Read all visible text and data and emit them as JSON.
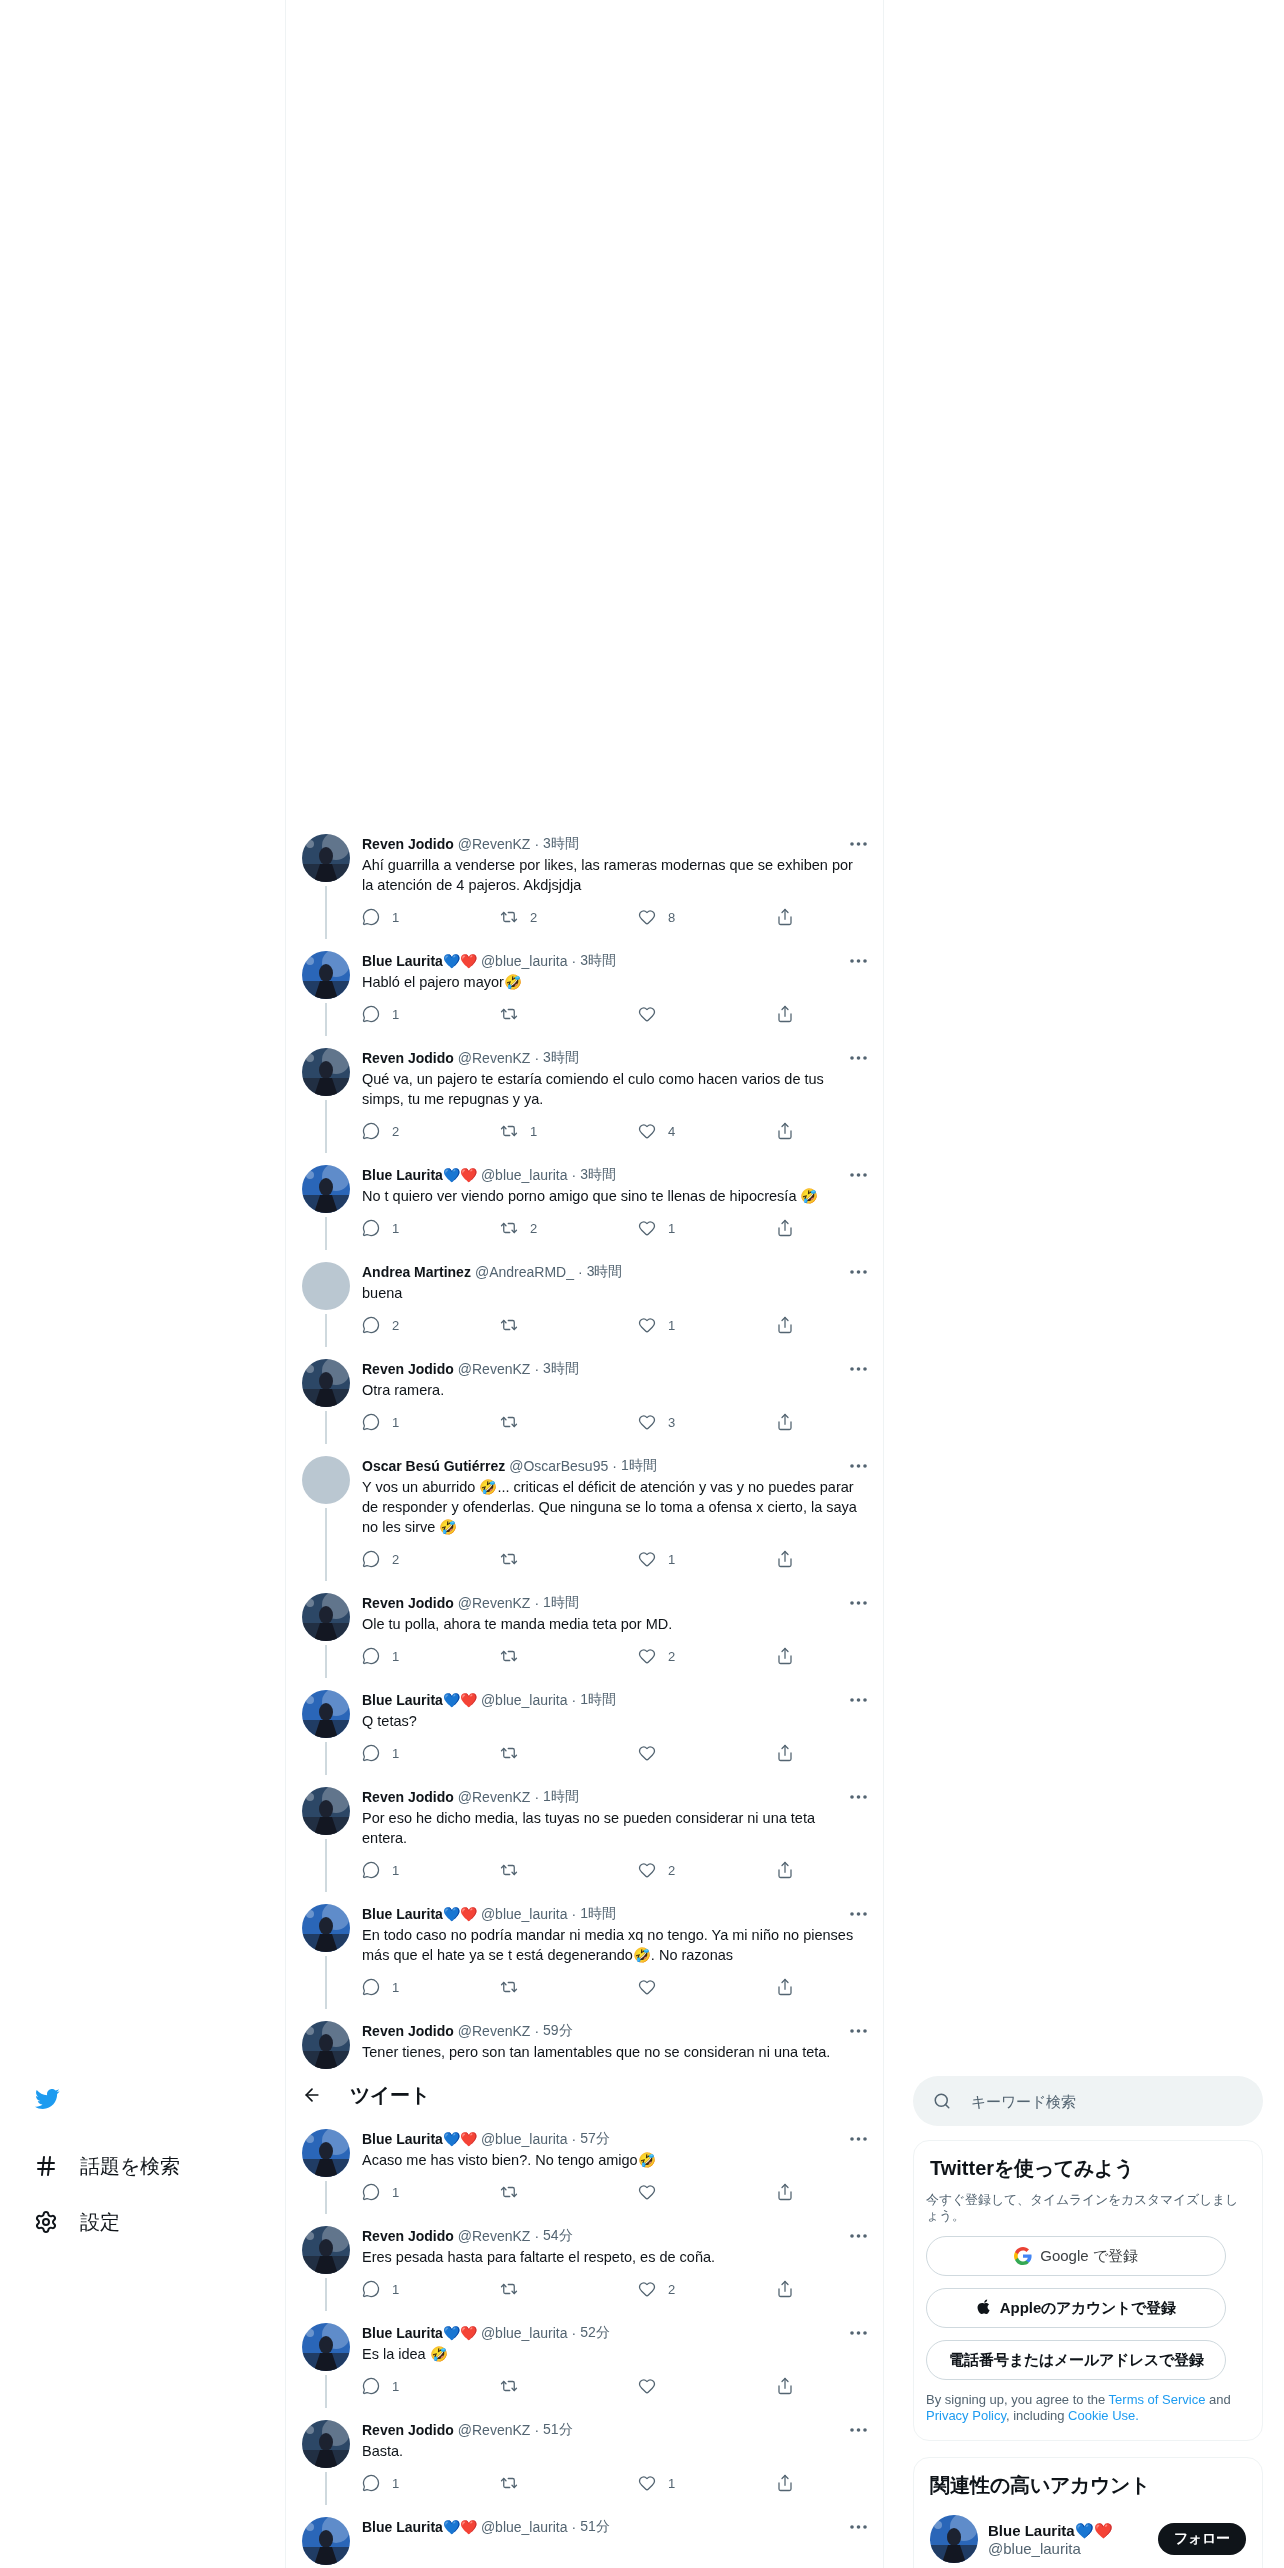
{
  "sidebar": {
    "items": [
      {
        "label": "話題を検索"
      },
      {
        "label": "設定"
      }
    ]
  },
  "timeline": [
    {
      "kind": "tweet",
      "name": "Reven Jodido",
      "handle": "@RevenKZ",
      "separator": "·",
      "time": "3時間",
      "text": "Ahí guarrilla a venderse por likes, las rameras modernas que se exhiben por la atención de 4 pajeros. Akdjsjdja",
      "actions": {
        "replies": "1",
        "retweets": "2",
        "likes": "8"
      }
    },
    {
      "kind": "tweet",
      "name": "Blue Laurita💙❤️",
      "handle": "@blue_laurita",
      "separator": "·",
      "time": "3時間",
      "text": "Habló el pajero mayor🤣",
      "actions": {
        "replies": "1"
      }
    },
    {
      "kind": "tweet",
      "name": "Reven Jodido",
      "handle": "@RevenKZ",
      "separator": "·",
      "time": "3時間",
      "text": "Qué va, un pajero te estaría comiendo el culo como hacen varios de tus simps, tu me repugnas y ya.",
      "actions": {
        "replies": "2",
        "retweets": "1",
        "likes": "4"
      }
    },
    {
      "kind": "tweet",
      "name": "Blue Laurita💙❤️",
      "handle": "@blue_laurita",
      "separator": "·",
      "time": "3時間",
      "text": "No t quiero ver viendo porno amigo que sino te llenas de hipocresía 🤣",
      "actions": {
        "replies": "1",
        "retweets": "2",
        "likes": "1"
      }
    },
    {
      "kind": "tweet",
      "name": "Andrea Martinez",
      "handle": "@AndreaRMD_",
      "separator": "·",
      "time": "3時間",
      "text": "buena",
      "avatar": {
        "kind": "blank",
        "color": "#bac7d1"
      },
      "actions": {
        "replies": "2",
        "likes": "1"
      }
    },
    {
      "kind": "tweet",
      "name": "Reven Jodido",
      "handle": "@RevenKZ",
      "separator": "·",
      "time": "3時間",
      "text": "Otra ramera.",
      "actions": {
        "replies": "1",
        "likes": "3"
      }
    },
    {
      "kind": "tweet",
      "name": "Oscar Besú Gutiérrez",
      "handle": "@OscarBesu95",
      "separator": "·",
      "time": "1時間",
      "text": "Y vos un aburrido 🤣... criticas el déficit de atención y vas y no puedes parar de responder y ofenderlas. Que ninguna se lo toma a ofensa x cierto, la saya no les sirve 🤣",
      "avatar": {
        "kind": "blank",
        "color": "#bac7d1"
      },
      "actions": {
        "replies": "2",
        "likes": "1"
      }
    },
    {
      "kind": "tweet",
      "name": "Reven Jodido",
      "handle": "@RevenKZ",
      "separator": "·",
      "time": "1時間",
      "text": "Ole tu polla, ahora te manda media teta por MD.",
      "actions": {
        "replies": "1",
        "likes": "2"
      }
    },
    {
      "kind": "tweet",
      "name": "Blue Laurita💙❤️",
      "handle": "@blue_laurita",
      "separator": "·",
      "time": "1時間",
      "text": "Q tetas?",
      "actions": {
        "replies": "1"
      }
    },
    {
      "kind": "tweet",
      "name": "Reven Jodido",
      "handle": "@RevenKZ",
      "separator": "·",
      "time": "1時間",
      "text": "Por eso he dicho media, las tuyas no se pueden considerar ni una teta entera.",
      "actions": {
        "replies": "1",
        "likes": "2"
      }
    },
    {
      "kind": "tweet",
      "name": "Blue Laurita💙❤️",
      "handle": "@blue_laurita",
      "separator": "·",
      "time": "1時間",
      "text": "En todo caso no podría mandar ni media xq no tengo. Ya mi niño no pienses más que el hate ya se t está degenerando🤣. No razonas",
      "actions": {
        "replies": "1"
      }
    },
    {
      "kind": "tweet",
      "name": "Reven Jodido",
      "handle": "@RevenKZ",
      "separator": "·",
      "time": "59分",
      "text": "Tener tienes, pero son tan lamentables que no se consideran ni una teta."
    },
    {
      "kind": "header",
      "title": "ツイート"
    },
    {
      "kind": "tweet",
      "name": "Blue Laurita💙❤️",
      "handle": "@blue_laurita",
      "separator": "·",
      "time": "57分",
      "text": "Acaso me has visto bien?. No tengo amigo🤣",
      "actions": {
        "replies": "1"
      }
    },
    {
      "kind": "tweet",
      "name": "Reven Jodido",
      "handle": "@RevenKZ",
      "separator": "·",
      "time": "54分",
      "text": "Eres pesada hasta para faltarte el respeto, es de coña.",
      "actions": {
        "replies": "1",
        "likes": "2"
      }
    },
    {
      "kind": "tweet",
      "name": "Blue Laurita💙❤️",
      "handle": "@blue_laurita",
      "separator": "·",
      "time": "52分",
      "text": "Es la idea 🤣",
      "actions": {
        "replies": "1"
      }
    },
    {
      "kind": "tweet",
      "name": "Reven Jodido",
      "handle": "@RevenKZ",
      "separator": "·",
      "time": "51分",
      "text": "Basta.",
      "actions": {
        "replies": "1",
        "likes": "1"
      }
    },
    {
      "kind": "tweet",
      "name": "Blue Laurita💙❤️",
      "handle": "@blue_laurita",
      "separator": "·",
      "time": "51分"
    }
  ],
  "search": {
    "placeholder": "キーワード検索"
  },
  "signup": {
    "title": "Twitterを使ってみよう",
    "subtitle": "今すぐ登録して、タイムラインをカスタマイズしましょう。",
    "buttons": [
      {
        "kind": "google",
        "label": "Google で登録"
      },
      {
        "kind": "apple",
        "label": "Appleのアカウントで登録"
      },
      {
        "kind": "plain",
        "label": "電話番号またはメールアドレスで登録"
      }
    ],
    "legal": [
      {
        "text": "By signing up, you agree to the ",
        "link": false
      },
      {
        "text": "Terms of Service",
        "link": true
      },
      {
        "text": " and ",
        "link": false
      },
      {
        "text": "Privacy Policy",
        "link": true
      },
      {
        "text": ", including ",
        "link": false
      },
      {
        "text": "Cookie Use.",
        "link": true
      }
    ]
  },
  "related": {
    "title": "関連性の高いアカウント",
    "accounts": [
      {
        "name": "Blue Laurita💙❤️",
        "handle": "@blue_laurita",
        "button": "フォロー"
      }
    ]
  }
}
